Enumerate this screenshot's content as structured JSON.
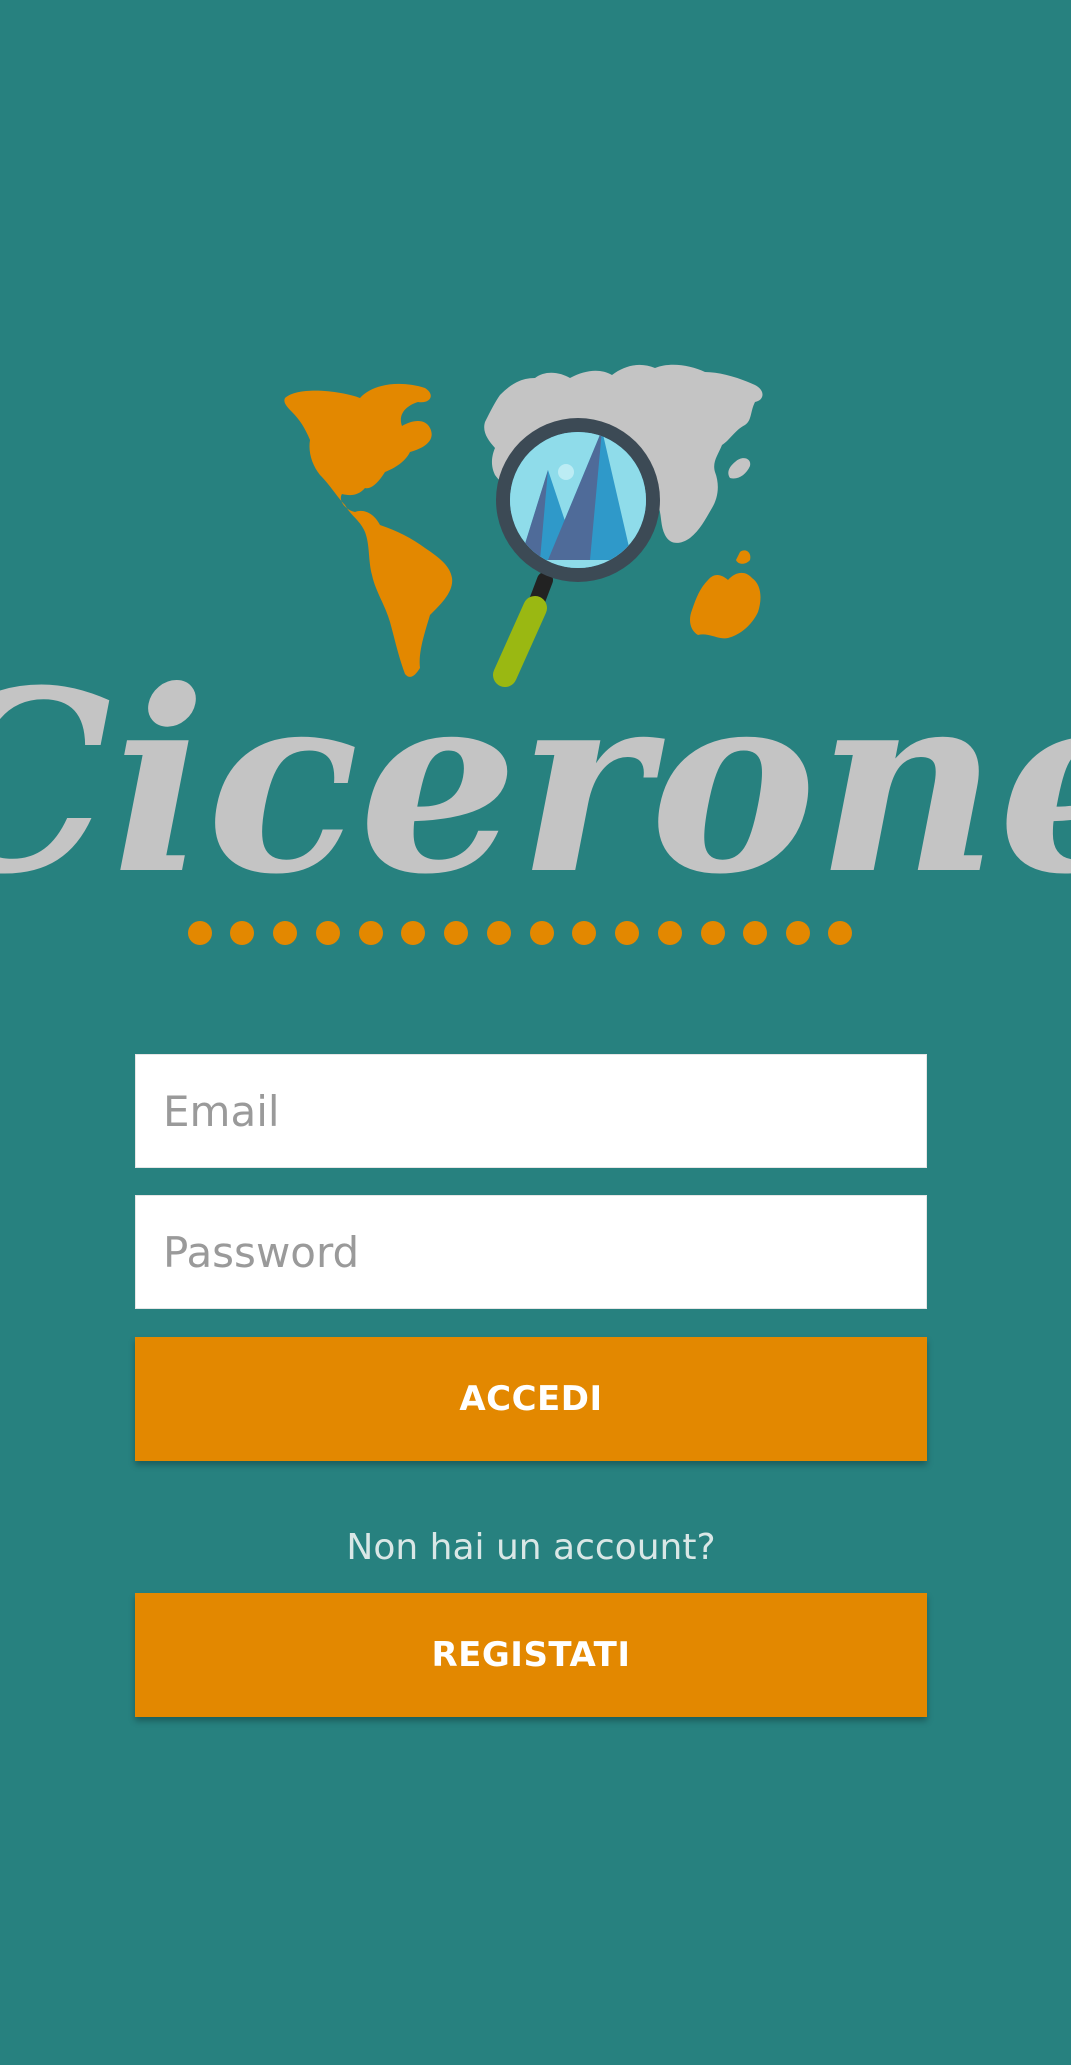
{
  "app": {
    "logo_text": "Cicerone"
  },
  "login_form": {
    "email_placeholder": "Email",
    "password_placeholder": "Password",
    "login_button_label": "ACCEDI",
    "no_account_prompt": "Non hai un account?",
    "register_button_label": "REGISTATI"
  },
  "colors": {
    "background": "#27817f",
    "accent": "#e38800",
    "logo_gray": "#c4c4c4",
    "text_light": "#d9e7e6"
  },
  "icons": [
    "world-map-icon",
    "magnifying-glass-icon",
    "mountain-icon"
  ]
}
